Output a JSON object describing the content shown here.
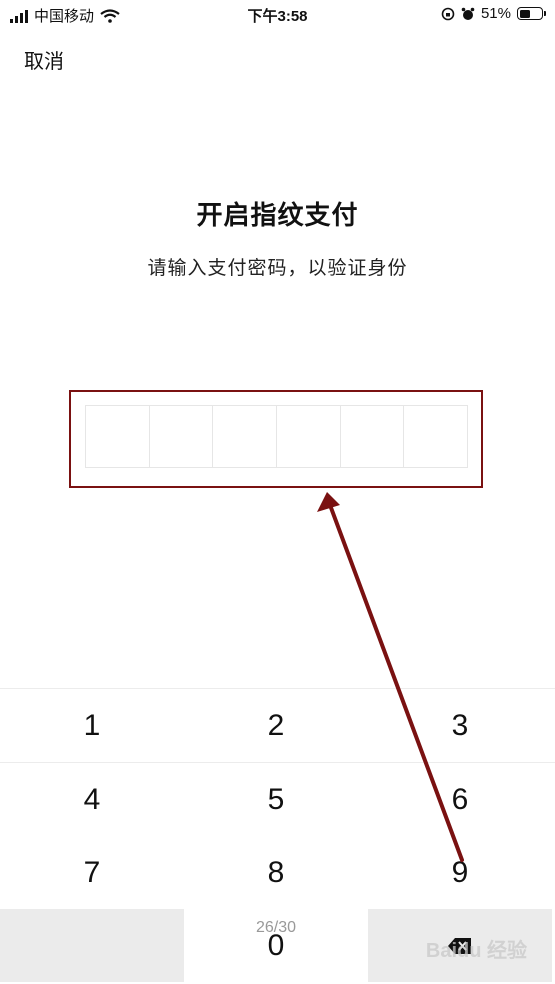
{
  "status_bar": {
    "carrier": "中国移动",
    "time": "下午3:58",
    "battery_text": "51%",
    "battery_level": 0.51
  },
  "header": {
    "cancel_label": "取消"
  },
  "main": {
    "title": "开启指纹支付",
    "subtitle": "请输入支付密码，以验证身份",
    "pin_length": 6
  },
  "keypad": {
    "keys": [
      "1",
      "2",
      "3",
      "4",
      "5",
      "6",
      "7",
      "8",
      "9",
      "0"
    ],
    "counter": "26/30"
  },
  "annotation": {
    "color": "#7a1111"
  },
  "watermark": "Baidu 经验"
}
